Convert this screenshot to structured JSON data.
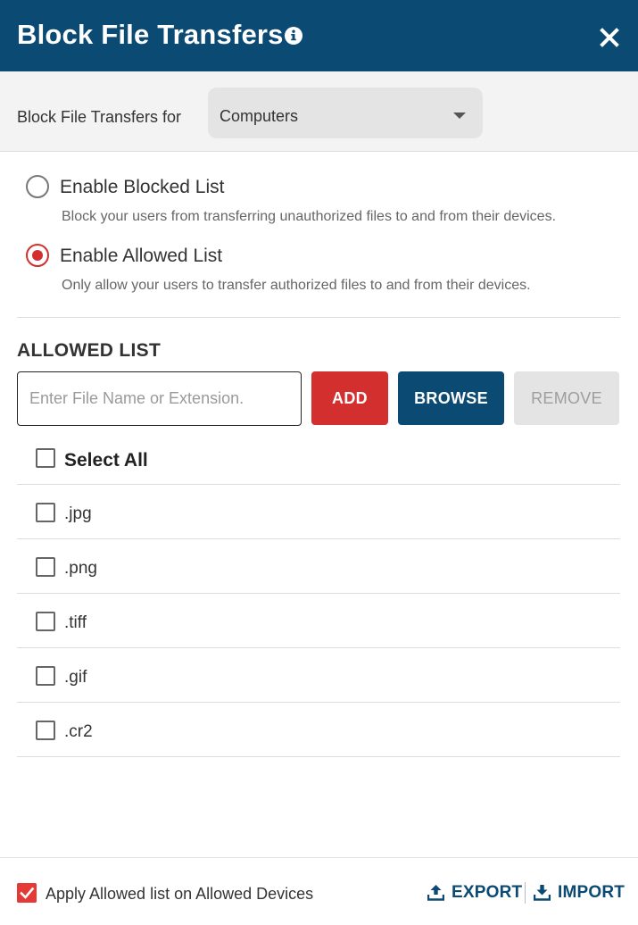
{
  "header": {
    "title": "Block File Transfers",
    "background": "#0b4a72"
  },
  "filter": {
    "label": "Block File Transfers for",
    "selected": "Computers"
  },
  "options": {
    "blocked": {
      "label": "Enable Blocked List",
      "description": "Block your users from transferring unauthorized files to and from their devices.",
      "selected": false
    },
    "allowed": {
      "label": "Enable Allowed List",
      "description": "Only allow your users to transfer authorized files to and from their devices.",
      "selected": true
    }
  },
  "list_section": {
    "title": "ALLOWED LIST",
    "input_placeholder": "Enter File Name or Extension.",
    "add_label": "ADD",
    "browse_label": "BROWSE",
    "remove_label": "REMOVE",
    "select_all_label": "Select All",
    "items": [
      ".jpg",
      ".png",
      ".tiff",
      ".gif",
      ".cr2"
    ]
  },
  "footer": {
    "apply_label": "Apply Allowed list on Allowed Devices",
    "apply_checked": true,
    "export_label": "EXPORT",
    "import_label": "IMPORT"
  },
  "colors": {
    "primary": "#0b4a72",
    "danger": "#d32f2f",
    "disabled": "#e4e4e4"
  }
}
